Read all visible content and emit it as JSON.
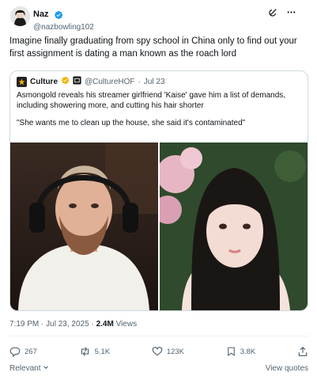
{
  "author": {
    "display_name": "Naz",
    "handle": "@nazbowling102"
  },
  "tweet": {
    "text": "Imagine finally graduating from spy school in China only to find out your first assignment is dating a man known as the roach lord"
  },
  "quote": {
    "author_name": "Culture",
    "handle": "@CultureHOF",
    "date": "Jul 23",
    "meta_separator": "·",
    "paragraph_1": "Asmongold reveals his streamer girlfriend 'Kaise' gave him a list of demands, including showering more, and cutting his hair shorter",
    "paragraph_2": "\"She wants me to clean up the house, she said it's contaminated\""
  },
  "meta": {
    "time": "7:19 PM",
    "separator": "·",
    "date": "Jul 23, 2025",
    "views_count": "2.4M",
    "views_label": "Views"
  },
  "actions": {
    "replies": "267",
    "reposts": "5.1K",
    "likes": "123K",
    "bookmarks": "3.8K"
  },
  "footer": {
    "sort_label": "Relevant",
    "view_quotes": "View quotes"
  },
  "colors": {
    "verified_blue": "#1d9bf0",
    "culture_badge": "#f4b400",
    "text_primary": "#0f1419",
    "text_secondary": "#536471"
  },
  "icons": {
    "header": [
      "grok-icon",
      "more-icon"
    ],
    "actions": [
      "reply-icon",
      "repost-icon",
      "like-icon",
      "bookmark-icon",
      "share-icon"
    ]
  }
}
